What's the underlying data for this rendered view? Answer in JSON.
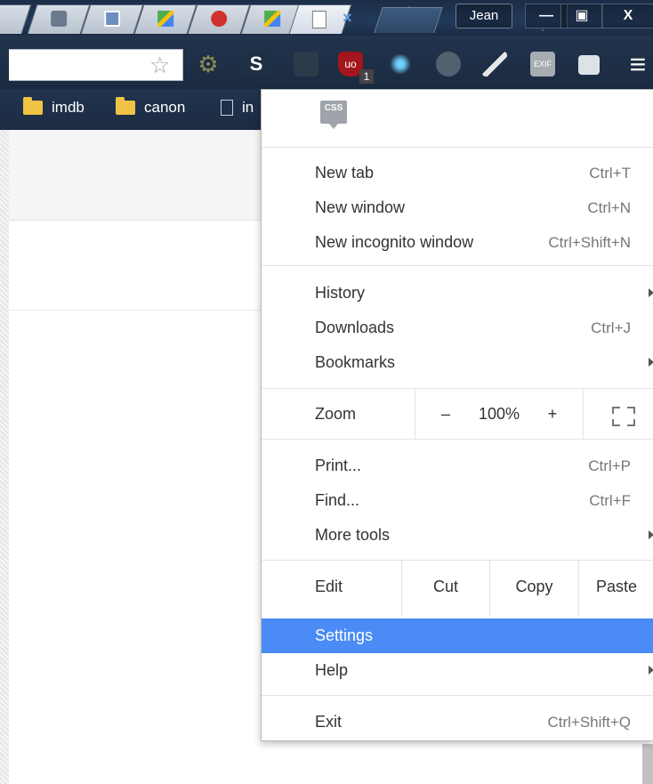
{
  "window": {
    "profile_name": "Jean",
    "minimize_glyph": "—",
    "maximize_glyph": "▣",
    "close_glyph": "X",
    "tab_close_glyph": "×"
  },
  "toolbar": {
    "bookmark_star": "☆",
    "menu_glyph": "≡",
    "extensions": [
      "settings-gear-icon",
      "s-extension-icon",
      "ublock-origin-icon",
      "extension-icon",
      "extension-icon",
      "extension-icon",
      "exif-viewer-icon",
      "extension-icon"
    ],
    "ublock_badge": "1",
    "s_label": "S",
    "exif_label": "EXIF"
  },
  "bookmarks": [
    {
      "label": "imdb",
      "icon": "folder-icon"
    },
    {
      "label": "canon",
      "icon": "folder-icon"
    },
    {
      "label": "in",
      "icon": "page-icon"
    }
  ],
  "menu": {
    "extension_badge": "CSS",
    "items_group1": [
      {
        "label": "New tab",
        "shortcut": "Ctrl+T"
      },
      {
        "label": "New window",
        "shortcut": "Ctrl+N"
      },
      {
        "label": "New incognito window",
        "shortcut": "Ctrl+Shift+N"
      }
    ],
    "items_group2": [
      {
        "label": "History",
        "submenu": true
      },
      {
        "label": "Downloads",
        "shortcut": "Ctrl+J"
      },
      {
        "label": "Bookmarks",
        "submenu": true
      }
    ],
    "zoom": {
      "label": "Zoom",
      "minus": "–",
      "value": "100%",
      "plus": "+"
    },
    "items_group3": [
      {
        "label": "Print...",
        "shortcut": "Ctrl+P"
      },
      {
        "label": "Find...",
        "shortcut": "Ctrl+F"
      },
      {
        "label": "More tools",
        "submenu": true
      }
    ],
    "edit": {
      "label": "Edit",
      "cut": "Cut",
      "copy": "Copy",
      "paste": "Paste"
    },
    "settings": "Settings",
    "help": "Help",
    "exit": {
      "label": "Exit",
      "shortcut": "Ctrl+Shift+Q"
    }
  },
  "colors": {
    "highlight": "#4b8bf5",
    "folder": "#f0c245",
    "title_bg": "#1b2d47"
  }
}
